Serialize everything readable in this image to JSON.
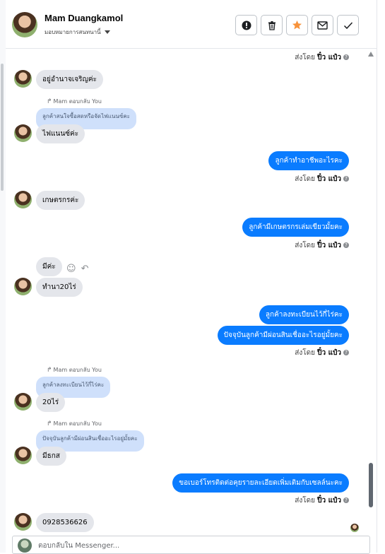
{
  "header": {
    "contact_name": "Mam Duangkamol",
    "assign_label": "มอบหมายการสนทนานี้",
    "actions": [
      "alert-icon",
      "trash-icon",
      "star-icon",
      "envelope-icon",
      "check-icon"
    ]
  },
  "colors": {
    "accent": "#0a7cff",
    "incoming": "#e4e6eb",
    "quote": "#cfe0fb",
    "star": "#f7923a"
  },
  "sent_by": {
    "prefix": "ส่งโดย",
    "name": "ปิ๋ว แป๋ว",
    "info_glyph": "?"
  },
  "messages": {
    "m1": "อยู่อำนาจเจริญค่ะ",
    "reply1": {
      "header": "Mam ตอบกลับ You",
      "quote": "ลูกค้าสนใจซื้อสดหรือจัดไฟแนนซ์คะ",
      "text": "ไฟแนนซ์ค่ะ"
    },
    "out1": "ลูกค้าทำอาชีพอะไรคะ",
    "m2": "เกษตรกรค่ะ",
    "out2": "ลูกค้ามีเกษตรกรเล่มเขียวมั้ยคะ",
    "m3": "มีค่ะ",
    "m4": "ทำนา20ไร่",
    "out3": "ลูกค้าลงทะเบียนไว้กี่ไร่คะ",
    "out4": "ปัจจุบันลูกค้ามีผ่อนสินเชื่ออะไรอยู่มั้ยคะ",
    "reply2": {
      "header": "Mam ตอบกลับ You",
      "quote": "ลูกค้าลงทะเบียนไว้กี่ไร่คะ",
      "text": "20ไร่"
    },
    "reply3": {
      "header": "Mam ตอบกลับ You",
      "quote": "ปัจจุบันลูกค้ามีผ่อนสินเชื่ออะไรอยู่มั้ยคะ",
      "text": "มีธกส"
    },
    "out5": "ขอเบอร์โทรติดต่อคุยรายละเอียดเพิ่มเติมกับเซลล์นะคะ",
    "m5": "0928536626"
  },
  "composer": {
    "placeholder": "ตอบกลับใน Messenger..."
  }
}
